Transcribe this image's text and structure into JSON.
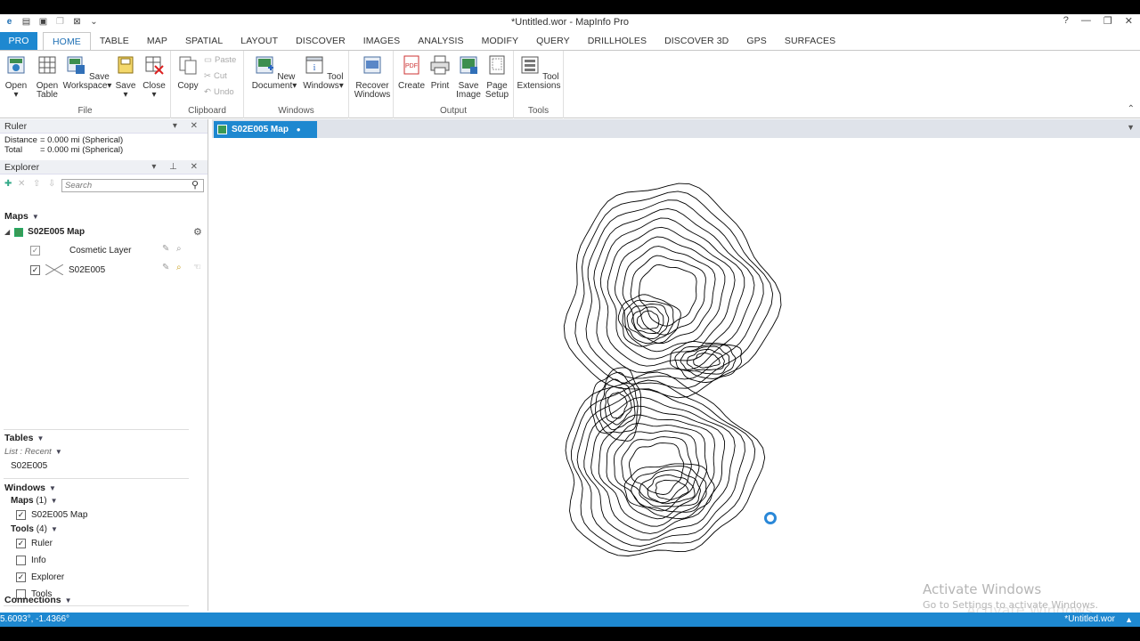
{
  "window": {
    "title": "*Untitled.wor - MapInfo Pro",
    "help": "?",
    "minimize": "—",
    "restore": "❐",
    "close": "✕"
  },
  "ribbon_tabs": [
    "PRO",
    "HOME",
    "TABLE",
    "MAP",
    "SPATIAL",
    "LAYOUT",
    "DISCOVER",
    "IMAGES",
    "ANALYSIS",
    "MODIFY",
    "QUERY",
    "DRILLHOLES",
    "DISCOVER 3D",
    "GPS",
    "SURFACES"
  ],
  "ribbon": {
    "file": {
      "label": "File",
      "open": "Open",
      "open_table_1": "Open",
      "open_table_2": "Table",
      "save_ws_1": "Save",
      "save_ws_2": "Workspace",
      "save": "Save",
      "close": "Close"
    },
    "clipboard": {
      "label": "Clipboard",
      "copy": "Copy",
      "paste": "Paste",
      "cut": "Cut",
      "undo": "Undo"
    },
    "windows": {
      "label": "Windows",
      "new_doc_1": "New",
      "new_doc_2": "Document",
      "tool_win_1": "Tool",
      "tool_win_2": "Windows",
      "recover_1": "Recover",
      "recover_2": "Windows"
    },
    "output": {
      "label": "Output",
      "create": "Create",
      "print": "Print",
      "save_img_1": "Save",
      "save_img_2": "Image",
      "page_1": "Page",
      "page_2": "Setup"
    },
    "tools": {
      "label": "Tools",
      "ext_1": "Tool",
      "ext_2": "Extensions"
    }
  },
  "ruler": {
    "title": "Ruler",
    "distance_label": "Distance",
    "distance_value": "= 0.000 mi (Spherical)",
    "total_label": "Total",
    "total_value": "= 0.000 mi (Spherical)"
  },
  "explorer": {
    "title": "Explorer",
    "search_placeholder": "Search",
    "maps_header": "Maps",
    "map_name": "S02E005 Map",
    "layers": [
      {
        "name": "Cosmetic Layer",
        "checked": true
      },
      {
        "name": "S02E005",
        "checked": true
      }
    ],
    "tables_header": "Tables",
    "list_recent": "List : Recent",
    "table_item": "S02E005",
    "windows_header": "Windows",
    "maps_sub": "Maps",
    "maps_count": "(1)",
    "map_window": "S02E005 Map",
    "tools_sub": "Tools",
    "tools_count": "(4)",
    "tools": [
      {
        "name": "Ruler",
        "checked": true
      },
      {
        "name": "Info",
        "checked": false
      },
      {
        "name": "Explorer",
        "checked": true
      },
      {
        "name": "Tools",
        "checked": false
      }
    ],
    "connections_header": "Connections"
  },
  "document": {
    "tab_label": "S02E005 Map"
  },
  "watermark": {
    "line1": "Activate Windows",
    "line2": "Go to Settings to activate Windows.",
    "line3": "Activate Windows"
  },
  "status": {
    "coords": "5.6093°, -1.4366°",
    "workspace": "*Untitled.wor"
  }
}
